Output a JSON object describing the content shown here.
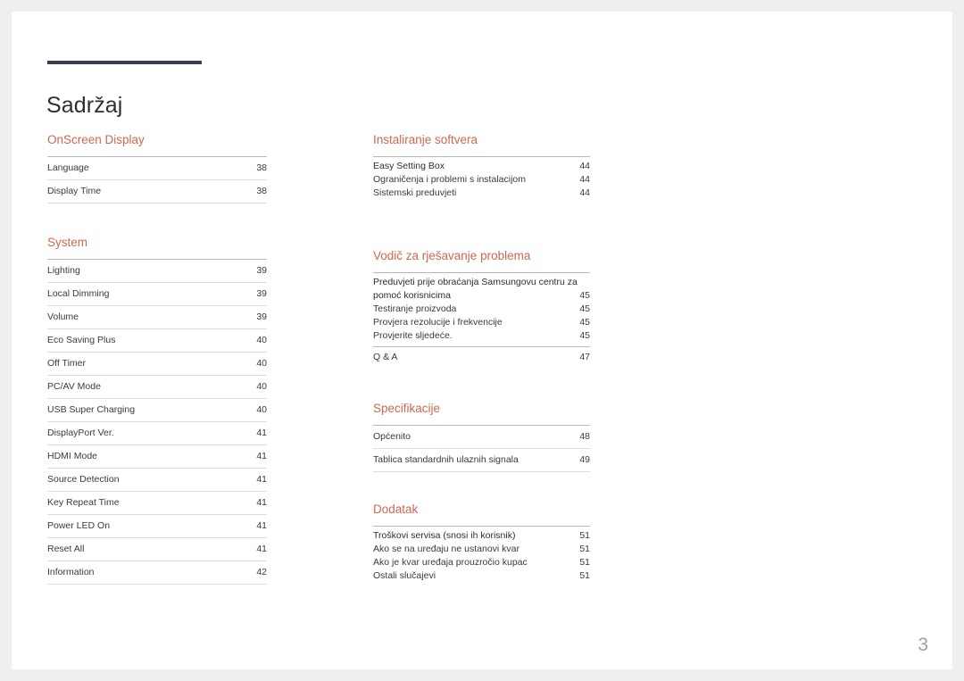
{
  "document": {
    "title": "Sadržaj",
    "folio": "3",
    "accent_color": "#cf6850",
    "rule_color": "#3d3d52",
    "folio_color": "#9aa2b0"
  },
  "columns": {
    "left": [
      {
        "heading": "OnScreen Display",
        "style": "ruled",
        "entries": [
          {
            "label": "Language",
            "page": "38"
          },
          {
            "label": "Display Time",
            "page": "38"
          }
        ]
      },
      {
        "heading": "System",
        "style": "ruled",
        "entries": [
          {
            "label": "Lighting",
            "page": "39"
          },
          {
            "label": "Local Dimming",
            "page": "39"
          },
          {
            "label": "Volume",
            "page": "39"
          },
          {
            "label": "Eco Saving Plus",
            "page": "40"
          },
          {
            "label": "Off Timer",
            "page": "40"
          },
          {
            "label": "PC/AV Mode",
            "page": "40"
          },
          {
            "label": "USB Super Charging",
            "page": "40"
          },
          {
            "label": "DisplayPort Ver.",
            "page": "41"
          },
          {
            "label": "HDMI Mode",
            "page": "41"
          },
          {
            "label": "Source Detection",
            "page": "41"
          },
          {
            "label": "Key Repeat Time",
            "page": "41"
          },
          {
            "label": "Power LED On",
            "page": "41"
          },
          {
            "label": "Reset All",
            "page": "41"
          },
          {
            "label": "Information",
            "page": "42"
          }
        ]
      }
    ],
    "right": [
      {
        "heading": "Instaliranje softvera",
        "style": "compact",
        "entries": [
          {
            "label": "Easy Setting Box",
            "page": "44"
          },
          {
            "label": "Ograničenja i problemi s instalacijom",
            "page": "44"
          },
          {
            "label": "Sistemski preduvjeti",
            "page": "44"
          }
        ]
      },
      {
        "heading": "Vodič za rješavanje problema",
        "style": "compact",
        "entries": [
          {
            "label": "Preduvjeti prije obraćanja Samsungovu centru za pomoć korisnicima",
            "line1": "Preduvjeti prije obraćanja Samsungovu centru za",
            "line2": "pomoć korisnicima",
            "page": "45",
            "wrap": true
          },
          {
            "label": "Testiranje proizvoda",
            "page": "45"
          },
          {
            "label": "Provjera rezolucije i frekvencije",
            "page": "45"
          },
          {
            "label": "Provjerite sljedeće.",
            "page": "45"
          }
        ],
        "footer_entry": {
          "label": "Q & A",
          "page": "47"
        }
      },
      {
        "heading": "Specifikacije",
        "style": "ruled",
        "entries": [
          {
            "label": "Općenito",
            "page": "48"
          },
          {
            "label": "Tablica standardnih ulaznih signala",
            "page": "49"
          }
        ]
      },
      {
        "heading": "Dodatak",
        "style": "compact",
        "entries": [
          {
            "label": "Troškovi servisa (snosi ih korisnik)",
            "page": "51"
          },
          {
            "label": "Ako se na uređaju ne ustanovi kvar",
            "page": "51"
          },
          {
            "label": "Ako je kvar uređaja prouzročio kupac",
            "page": "51"
          },
          {
            "label": "Ostali slučajevi",
            "page": "51"
          }
        ]
      }
    ]
  }
}
